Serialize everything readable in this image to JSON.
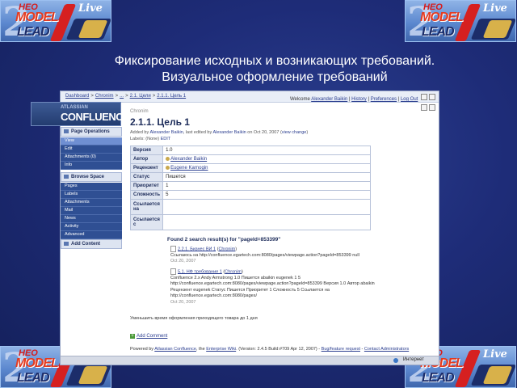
{
  "logos": {
    "big_digit": "2",
    "red_tag": "НЕО",
    "line1": "MODEL",
    "line2": "LEAD",
    "live": "Live"
  },
  "slide": {
    "title_line1": "Фиксирование исходных и возникающих требований.",
    "title_line2": "Визуальное оформление требований"
  },
  "app": {
    "breadcrumbs": [
      "Dashboard",
      "Chronim",
      "...",
      "2.1. Цели",
      "2.1.1. Цель 1"
    ],
    "user": {
      "welcome": "Welcome",
      "name": "Alexander Baikin",
      "history": "History",
      "preferences": "Preferences",
      "logout": "Log Out"
    },
    "brand": {
      "line1": "ATLASSIAN",
      "line2": "CONFLUENCE"
    },
    "sidebar": {
      "page_ops": "Page Operations",
      "page_items": [
        "View",
        "Edit",
        "Attachments (0)",
        "Info"
      ],
      "browse": "Browse Space",
      "space_items": [
        "Pages",
        "Labels",
        "Attachments",
        "Mail",
        "News",
        "Activity",
        "Advanced"
      ],
      "add": "Add Content"
    },
    "page": {
      "space": "Chronim",
      "title": "2.1.1. Цель 1",
      "meta_added": "Added by",
      "meta_added_user": "Alexander Baikin",
      "meta_edited": ", last edited by",
      "meta_edited_user": "Alexander Baikin",
      "meta_on": "on Oct 20, 2007 (",
      "meta_view_change": "view change",
      "meta_close": ")",
      "labels_text": "Labels: (None)",
      "labels_edit": "EDIT"
    },
    "props": [
      {
        "k": "Версия",
        "v": "1.0"
      },
      {
        "k": "Автор",
        "v": "Alexander Baikin",
        "link": true
      },
      {
        "k": "Рецензент",
        "v": "Eugene Karnogin",
        "link": true
      },
      {
        "k": "Статус",
        "v": "Пишется"
      },
      {
        "k": "Приоритет",
        "v": "1"
      },
      {
        "k": "Сложность",
        "v": "5"
      },
      {
        "k": "Ссылается на",
        "v": ""
      },
      {
        "k": "Ссылается с",
        "v": ""
      }
    ],
    "search": {
      "found": "Found 2 search result(s) for \"pageId=853399\"",
      "results": [
        {
          "title": "2.2.1. Бизнес ВИ 1",
          "space": "Chronim",
          "body": "Ссылаюсь на http://confluence.egartech.com:8080/pages/viewpage.action?pageId=853399 null",
          "date": "Oct 20, 2007"
        },
        {
          "title": "5.1. НФ требование 1",
          "space": "Chronim",
          "body": "Confluence 2.x Andy Armstrong 1.0 Пишется abaikin eugenek 1 5 http://confluence.egartech.com:8080/pages/viewpage.action?pageId=853399 Версия 1.0 Автор abaikin Рецензент eugenek Статус Пишется Приоритет 1 Сложность 5 Ссылается на http://confluence.egartech.com:8080/pages/",
          "date": "Oct 20, 2007"
        }
      ]
    },
    "footer_note": "Уменьшить время оформления приходящего товара до 1 дня",
    "add_comment": "Add Comment",
    "powered": {
      "prefix": "Powered by",
      "atlassian": "Atlassian Confluence",
      "mid": ", the",
      "wiki": "Enterprise Wiki",
      "version": ". (Version: 2.4.5 Build:#709 Apr 12, 2007) -",
      "bug": "Bug/feature request",
      "sep": "-",
      "contact": "Contact Administrators"
    },
    "status": {
      "zone": "Интернет"
    }
  }
}
